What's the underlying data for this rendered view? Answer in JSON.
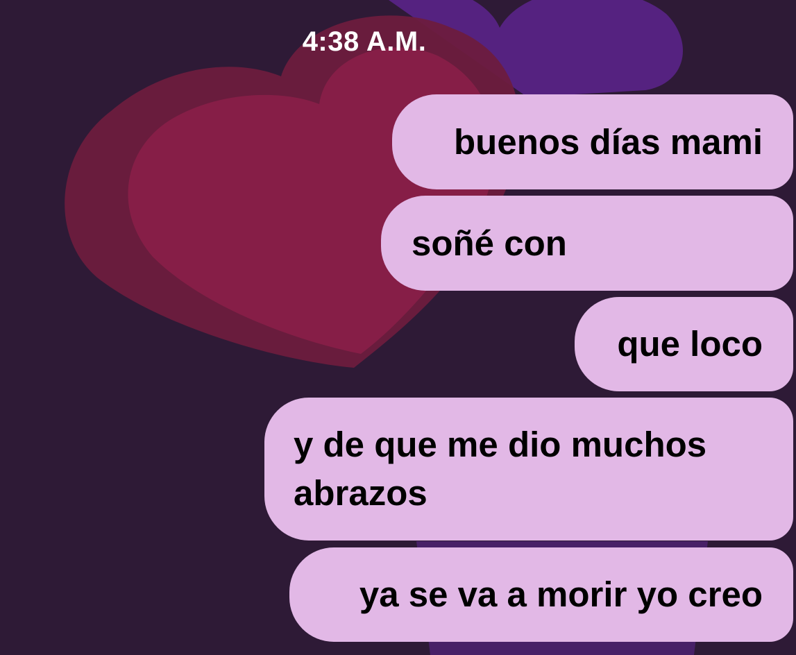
{
  "conversation": {
    "timestamp": "4:38 A.M.",
    "messages": [
      {
        "text": "buenos días mami"
      },
      {
        "text": "soñé con"
      },
      {
        "text": "que loco"
      },
      {
        "text": "y de que me dio muchos abrazos"
      },
      {
        "text": "ya se va a morir yo creo"
      }
    ]
  },
  "theme": {
    "background": "#2e1a36",
    "bubble_color": "#e2b8e6",
    "heart_colors": [
      "#7a1e44",
      "#8c2050",
      "#6a2a8e"
    ]
  },
  "icons": [
    "heart-wallpaper"
  ]
}
